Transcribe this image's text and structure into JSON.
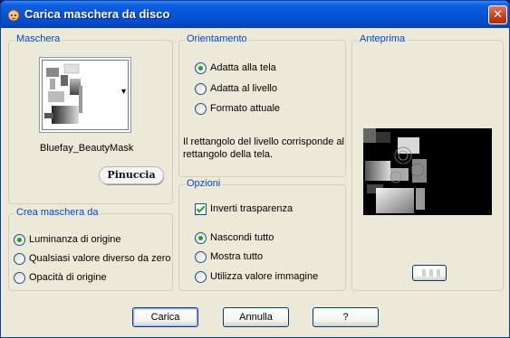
{
  "window": {
    "title": "Carica maschera da disco",
    "close_glyph": "✕"
  },
  "maschera": {
    "group_title": "Maschera",
    "mask_name": "Bluefay_BeautyMask",
    "logo_text": "Pinuccia",
    "dropdown_glyph": "▾"
  },
  "crea_maschera": {
    "group_title": "Crea maschera da",
    "options": [
      {
        "label": "Luminanza di origine",
        "checked": true
      },
      {
        "label": "Qualsiasi valore diverso da zero",
        "checked": false
      },
      {
        "label": "Opacità di origine",
        "checked": false
      }
    ]
  },
  "orientamento": {
    "group_title": "Orientamento",
    "options": [
      {
        "label": "Adatta alla tela",
        "checked": true
      },
      {
        "label": "Adatta al livello",
        "checked": false
      },
      {
        "label": "Formato attuale",
        "checked": false
      }
    ],
    "description_line1": "Il rettangolo del livello corrisponde al",
    "description_line2": "rettangolo della tela."
  },
  "opzioni": {
    "group_title": "Opzioni",
    "invert_label": "Inverti trasparenza",
    "invert_checked": true,
    "options": [
      {
        "label": "Nascondi tutto",
        "checked": true
      },
      {
        "label": "Mostra tutto",
        "checked": false
      },
      {
        "label": "Utilizza valore immagine",
        "checked": false
      }
    ]
  },
  "anteprima": {
    "group_title": "Anteprima"
  },
  "buttons": {
    "load": "Carica",
    "cancel": "Annulla",
    "help": "?"
  },
  "colors": {
    "title_bar": "#0553d4",
    "group_title": "#0046d5",
    "dialog_bg": "#ece9d8",
    "radio_dot": "#21a121",
    "close_button": "#c8401c"
  }
}
